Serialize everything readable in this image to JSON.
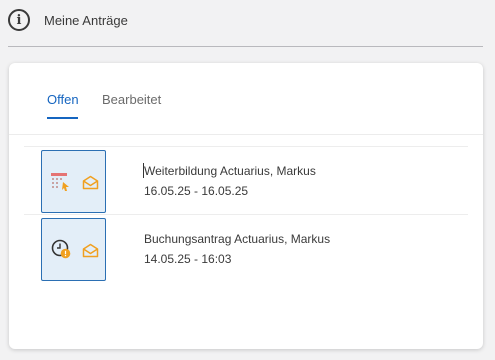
{
  "header": {
    "title": "Meine Anträge",
    "icon": "info-icon"
  },
  "tabs": [
    {
      "label": "Offen",
      "active": true
    },
    {
      "label": "Bearbeitet",
      "active": false
    }
  ],
  "requests": [
    {
      "title": "Weiterbildung Actuarius, Markus",
      "date": "16.05.25 - 16.05.25",
      "type_icon": "calendar-training-icon",
      "status_icon": "envelope-icon"
    },
    {
      "title": "Buchungsantrag Actuarius, Markus",
      "date": "14.05.25 - 16:03",
      "type_icon": "clock-warning-icon",
      "status_icon": "envelope-icon"
    }
  ],
  "colors": {
    "accent": "#1565c0",
    "thumb_bg": "#e3eef8",
    "thumb_border": "#2b6fb3",
    "mail_icon": "#f0a020"
  }
}
